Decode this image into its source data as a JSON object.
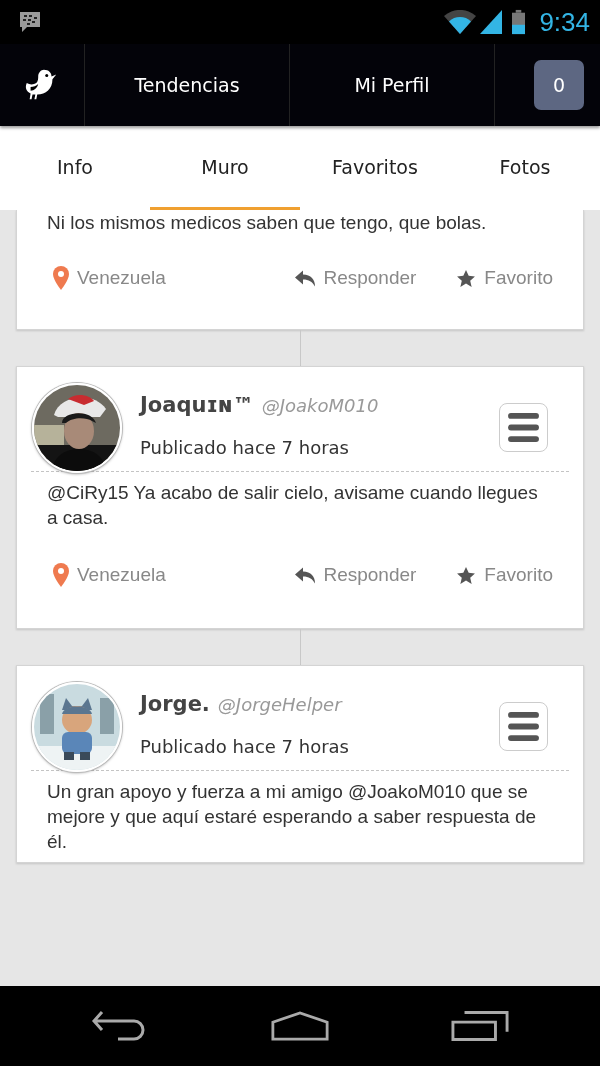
{
  "status_bar": {
    "time": "9:34"
  },
  "top_nav": {
    "items": [
      {
        "label": "Tendencias"
      },
      {
        "label": "Mi Perfil"
      }
    ],
    "notification_count": "0"
  },
  "tabs": [
    {
      "label": "Info",
      "selected": false
    },
    {
      "label": "Muro",
      "selected": true
    },
    {
      "label": "Favoritos",
      "selected": false
    },
    {
      "label": "Fotos",
      "selected": false
    }
  ],
  "posts": [
    {
      "body": "Ni los mismos medicos saben que tengo, que bolas.",
      "location": "Venezuela",
      "actions": [
        "Responder",
        "Favorito"
      ]
    },
    {
      "author": {
        "name": "Joaquɪɴ™",
        "handle": "@JoakoM010"
      },
      "time": "Publicado hace 7 horas",
      "body": "@CiRy15 Ya acabo de salir cielo, avisame cuando llegues a casa.",
      "location": "Venezuela",
      "actions": [
        "Responder",
        "Favorito"
      ]
    },
    {
      "author": {
        "name": "Jorge.",
        "handle": "@JorgeHelper"
      },
      "time": "Publicado hace 7 horas",
      "body": "Un gran apoyo y fuerza a mi amigo @JoakoM010 que se mejore y que aquí estaré esperando a saber respuesta de él."
    }
  ]
}
